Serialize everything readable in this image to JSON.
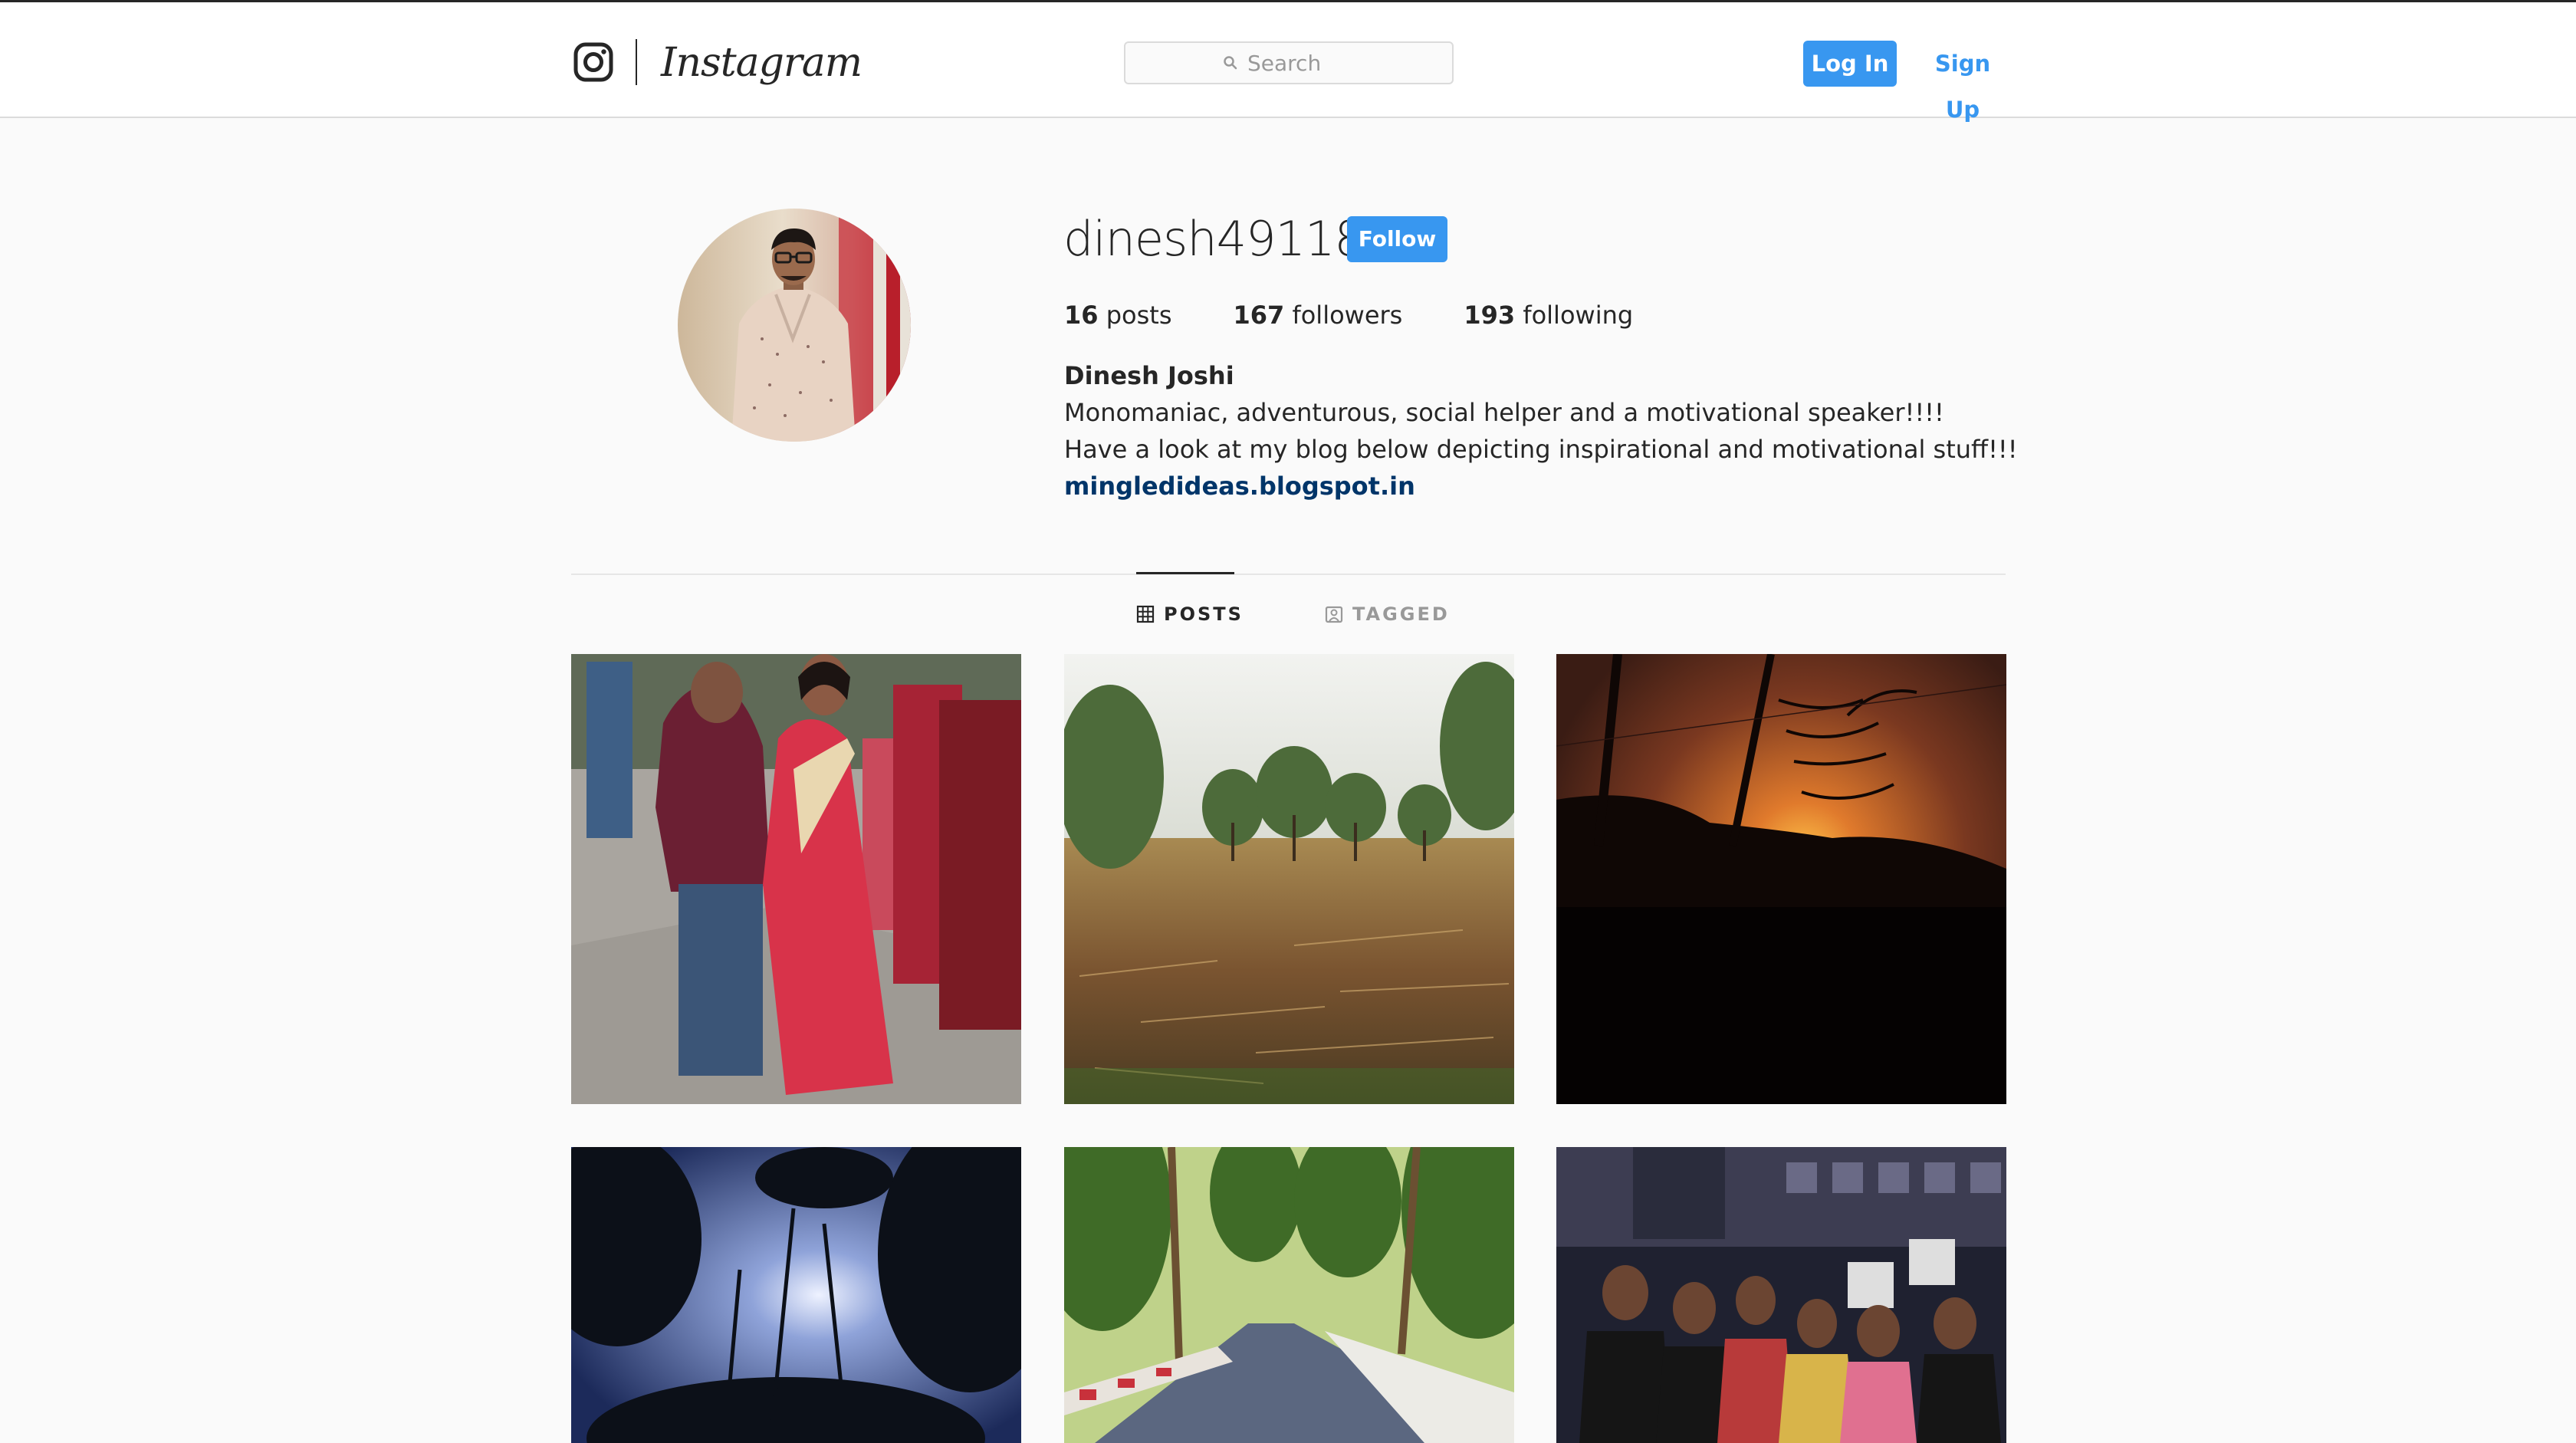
{
  "header": {
    "logo_icon": "instagram-camera-icon",
    "wordmark": "Instagram",
    "search": {
      "placeholder": "Search",
      "icon": "search-icon"
    },
    "login_label": "Log In",
    "signup_label": "Sign Up",
    "accent_color": "#3897f0"
  },
  "profile": {
    "username": "dinesh49118",
    "follow_label": "Follow",
    "stats": {
      "posts_count": "16",
      "posts_label": "posts",
      "followers_count": "167",
      "followers_label": "followers",
      "following_count": "193",
      "following_label": "following"
    },
    "full_name": "Dinesh Joshi",
    "bio_line1": "Monomaniac, adventurous, social helper and a motivational speaker!!!!",
    "bio_line2": "Have a look at my blog below depicting inspirational and motivational stuff!!!",
    "website": "mingledideas.blogspot.in"
  },
  "tabs": [
    {
      "label": "POSTS",
      "icon": "grid-icon",
      "active": true
    },
    {
      "label": "TAGGED",
      "icon": "tag-person-icon",
      "active": false
    }
  ]
}
